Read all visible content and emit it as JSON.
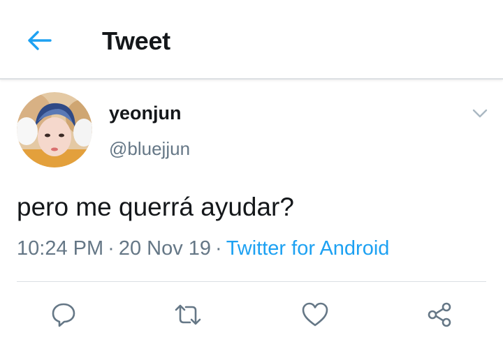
{
  "header": {
    "title": "Tweet",
    "back_icon": "arrow-left-icon"
  },
  "colors": {
    "accent": "#1da1f2",
    "text": "#14171a",
    "secondary": "#657786",
    "action_icon": "#657786"
  },
  "tweet": {
    "author": {
      "display_name": "yeonjun",
      "handle": "@bluejjun",
      "avatar": "profile-photo"
    },
    "text": "pero me querrá ayudar?",
    "time": "10:24 PM",
    "separator": "·",
    "date": "20 Nov 19",
    "source": "Twitter for Android"
  },
  "actions": [
    {
      "name": "reply",
      "icon": "reply-icon"
    },
    {
      "name": "retweet",
      "icon": "retweet-icon"
    },
    {
      "name": "like",
      "icon": "heart-icon"
    },
    {
      "name": "share",
      "icon": "share-icon"
    }
  ]
}
